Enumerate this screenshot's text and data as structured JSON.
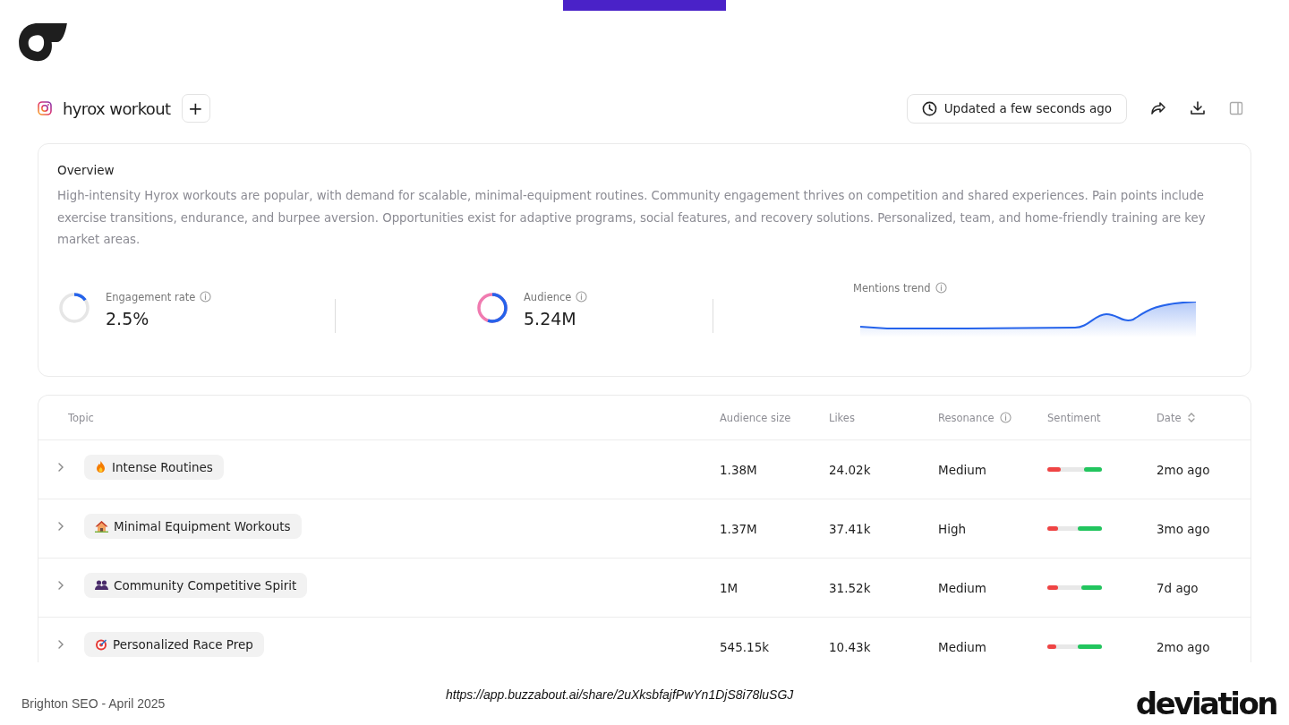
{
  "header": {
    "title": "hyrox workout",
    "add_label": "+",
    "updated": "Updated a few seconds ago"
  },
  "overview": {
    "title": "Overview",
    "summary": "High-intensity Hyrox workouts are popular, with demand for scalable, minimal-equipment routines. Community engagement thrives on competition and shared experiences. Pain points include exercise transitions, endurance, and burpee aversion. Opportunities exist for adaptive programs, social features, and recovery solutions. Personalized, team, and home-friendly training are key market areas.",
    "metrics": [
      {
        "kind": "ring",
        "label": "Engagement rate",
        "value": "2.5%",
        "level": 0.15
      },
      {
        "kind": "split",
        "label": "Audience",
        "value": "5.24M",
        "level": 0.55
      },
      {
        "kind": "trend",
        "label": "Mentions trend"
      }
    ]
  },
  "table": {
    "columns": [
      "Topic",
      "Audience size",
      "Likes",
      "Resonance",
      "Sentiment",
      "Date"
    ],
    "rows": [
      {
        "topic": "Intense Routines",
        "audience": "1.38M",
        "likes": "24.02k",
        "resonance": "Medium",
        "sentiment": [
          {
            "kind": "negative",
            "level": 0.25
          },
          {
            "kind": "positive",
            "level": 0.33
          }
        ],
        "date": "2mo ago"
      },
      {
        "topic": "Minimal Equipment Workouts",
        "audience": "1.37M",
        "likes": "37.41k",
        "resonance": "High",
        "sentiment": [
          {
            "kind": "negative",
            "level": 0.2
          },
          {
            "kind": "positive",
            "level": 0.45
          }
        ],
        "date": "3mo ago"
      },
      {
        "topic": "Community Competitive Spirit",
        "audience": "1M",
        "likes": "31.52k",
        "resonance": "Medium",
        "sentiment": [
          {
            "kind": "negative",
            "level": 0.2
          },
          {
            "kind": "positive",
            "level": 0.38
          }
        ],
        "date": "7d ago"
      },
      {
        "topic": "Personalized Race Prep",
        "audience": "545.15k",
        "likes": "10.43k",
        "resonance": "Medium",
        "sentiment": [
          {
            "kind": "negative",
            "level": 0.16
          },
          {
            "kind": "positive",
            "level": 0.44
          }
        ],
        "date": "2mo ago"
      }
    ]
  },
  "footer": {
    "event": "Brighton SEO - April 2025",
    "url": "https://app.buzzabout.ai/share/2uXksbfajfPwYn1DjS8i78luSGJ",
    "brand": "deviation"
  }
}
